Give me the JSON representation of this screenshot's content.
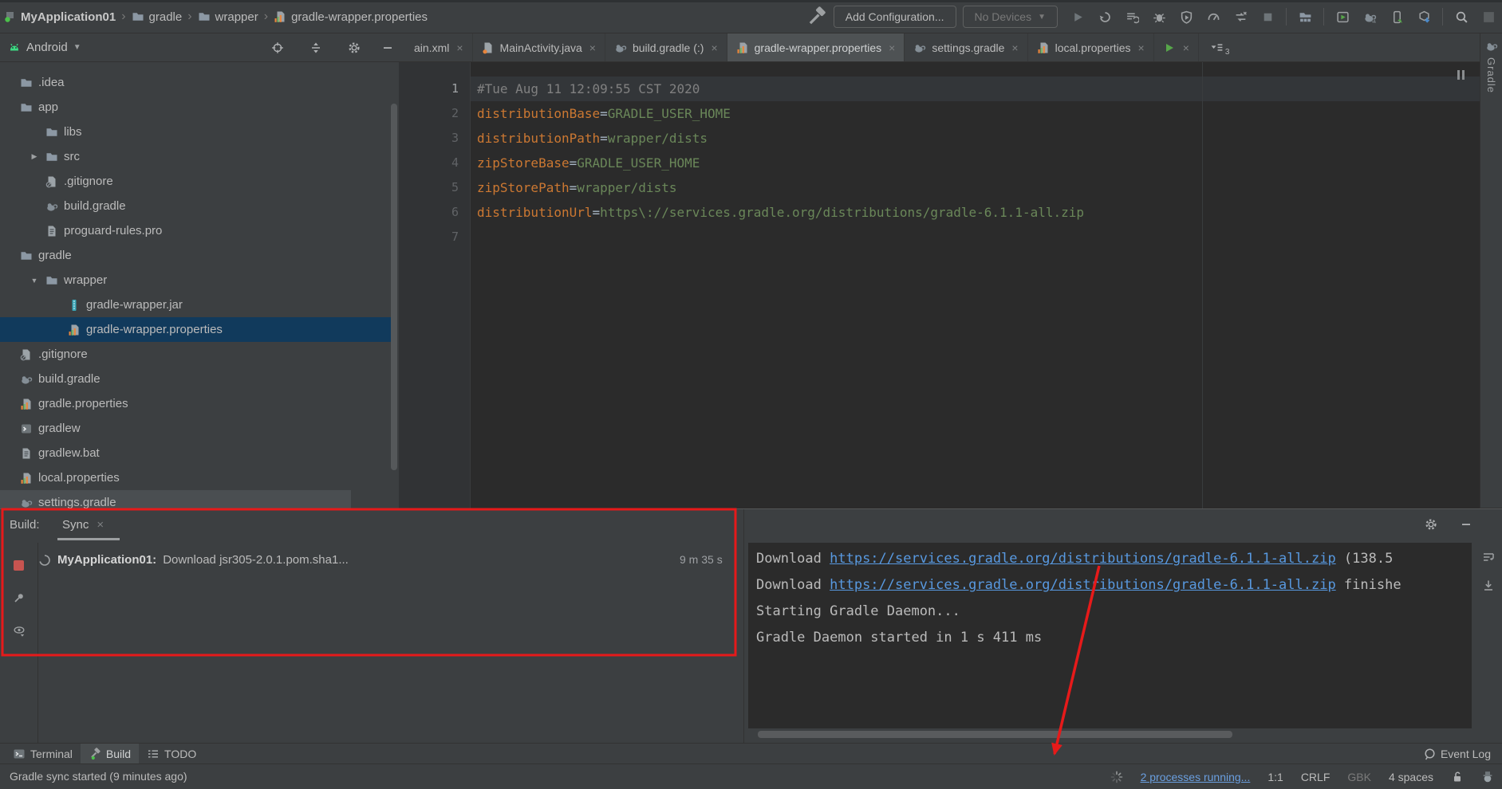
{
  "toolbar": {
    "breadcrumbs": [
      {
        "label": "MyApplication01",
        "icon": "project"
      },
      {
        "label": "gradle",
        "icon": "folder"
      },
      {
        "label": "wrapper",
        "icon": "folder"
      },
      {
        "label": "gradle-wrapper.properties",
        "icon": "properties"
      }
    ],
    "add_configuration_label": "Add Configuration...",
    "device_selector_label": "No Devices",
    "right_icons": [
      "play",
      "sync-restart",
      "profile-list",
      "bug",
      "shield-play",
      "gauge",
      "forced-sync",
      "stop",
      "|",
      "project-structure",
      "|",
      "logcat",
      "elephant-sync",
      "device-manager",
      "sdk-manager",
      "|",
      "search",
      "account-square"
    ]
  },
  "project_panel": {
    "view_title": "Android",
    "items": [
      {
        "label": ".idea",
        "icon": "folder",
        "indent": 0
      },
      {
        "label": "app",
        "icon": "folder",
        "indent": 0
      },
      {
        "label": "libs",
        "icon": "folder",
        "indent": 1
      },
      {
        "label": "src",
        "icon": "folder",
        "indent": 1,
        "chevron": "right"
      },
      {
        "label": ".gitignore",
        "icon": "gitignore",
        "indent": 1
      },
      {
        "label": "build.gradle",
        "icon": "gradle",
        "indent": 1
      },
      {
        "label": "proguard-rules.pro",
        "icon": "textfile",
        "indent": 1
      },
      {
        "label": "gradle",
        "icon": "folder",
        "indent": 0
      },
      {
        "label": "wrapper",
        "icon": "folder",
        "indent": 1,
        "chevron": "down"
      },
      {
        "label": "gradle-wrapper.jar",
        "icon": "jar",
        "indent": 2
      },
      {
        "label": "gradle-wrapper.properties",
        "icon": "properties",
        "indent": 2,
        "selected": true
      },
      {
        "label": ".gitignore",
        "icon": "gitignore",
        "indent": 0
      },
      {
        "label": "build.gradle",
        "icon": "gradle",
        "indent": 0
      },
      {
        "label": "gradle.properties",
        "icon": "properties",
        "indent": 0
      },
      {
        "label": "gradlew",
        "icon": "gradlew",
        "indent": 0
      },
      {
        "label": "gradlew.bat",
        "icon": "textfile",
        "indent": 0
      },
      {
        "label": "local.properties",
        "icon": "properties",
        "indent": 0
      },
      {
        "label": "settings.gradle",
        "icon": "gradle",
        "indent": 0,
        "hovered": true
      }
    ]
  },
  "editor": {
    "tabs": [
      {
        "label": "ain.xml",
        "icon": "",
        "active": false
      },
      {
        "label": "MainActivity.java",
        "icon": "java",
        "active": false
      },
      {
        "label": "build.gradle (:)",
        "icon": "gradle",
        "active": false
      },
      {
        "label": "gradle-wrapper.properties",
        "icon": "properties",
        "active": true
      },
      {
        "label": "settings.gradle",
        "icon": "gradle",
        "active": false
      },
      {
        "label": "local.properties",
        "icon": "properties",
        "active": false
      },
      {
        "label": "",
        "icon": "run-tab",
        "active": false
      }
    ],
    "hidden_tabs_count": "3",
    "code_lines": [
      {
        "num": "1",
        "current": true,
        "tokens": [
          {
            "text": "#Tue Aug 11 12:09:55 CST 2020",
            "type": "comment"
          }
        ]
      },
      {
        "num": "2",
        "tokens": [
          {
            "text": "distributionBase",
            "type": "key"
          },
          {
            "text": "=",
            "type": "op"
          },
          {
            "text": "GRADLE_USER_HOME",
            "type": "value"
          }
        ]
      },
      {
        "num": "3",
        "tokens": [
          {
            "text": "distributionPath",
            "type": "key"
          },
          {
            "text": "=",
            "type": "op"
          },
          {
            "text": "wrapper/dists",
            "type": "value"
          }
        ]
      },
      {
        "num": "4",
        "tokens": [
          {
            "text": "zipStoreBase",
            "type": "key"
          },
          {
            "text": "=",
            "type": "op"
          },
          {
            "text": "GRADLE_USER_HOME",
            "type": "value"
          }
        ]
      },
      {
        "num": "5",
        "tokens": [
          {
            "text": "zipStorePath",
            "type": "key"
          },
          {
            "text": "=",
            "type": "op"
          },
          {
            "text": "wrapper/dists",
            "type": "value"
          }
        ]
      },
      {
        "num": "6",
        "tokens": [
          {
            "text": "distributionUrl",
            "type": "key"
          },
          {
            "text": "=",
            "type": "op"
          },
          {
            "text": "https\\://services.gradle.org/distributions/gradle-6.1.1-all.zip",
            "type": "value"
          }
        ]
      },
      {
        "num": "7",
        "tokens": []
      }
    ]
  },
  "right_stripe": {
    "label": "Gradle"
  },
  "build_panel": {
    "label": "Build:",
    "tab_label": "Sync",
    "task_name": "MyApplication01:",
    "task_text": "Download jsr305-2.0.1.pom.sha1...",
    "task_time": "9 m 35 s",
    "console_lines": [
      {
        "prefix": "Download ",
        "link": "https://services.gradle.org/distributions/gradle-6.1.1-all.zip",
        "suffix": " (138.5"
      },
      {
        "prefix": "Download ",
        "link": "https://services.gradle.org/distributions/gradle-6.1.1-all.zip",
        "suffix": " finishe"
      },
      {
        "text": "Starting Gradle Daemon..."
      },
      {
        "text": "Gradle Daemon started in 1 s 411 ms"
      }
    ]
  },
  "bottom_bar": {
    "terminal_label": "Terminal",
    "build_label": "Build",
    "todo_label": "TODO",
    "event_log_label": "Event Log"
  },
  "status_bar": {
    "message": "Gradle sync started (9 minutes ago)",
    "processes_label": "2 processes running...",
    "caret_position": "1:1",
    "line_separator": "CRLF",
    "encoding": "GBK",
    "indent_label": "4 spaces"
  },
  "colors": {
    "annotation_red": "#E61A1A",
    "link_blue": "#5899E0",
    "selection_blue": "#113A5C",
    "key_orange": "#CC7832",
    "value_green": "#6A8759",
    "comment_gray": "#808080"
  }
}
